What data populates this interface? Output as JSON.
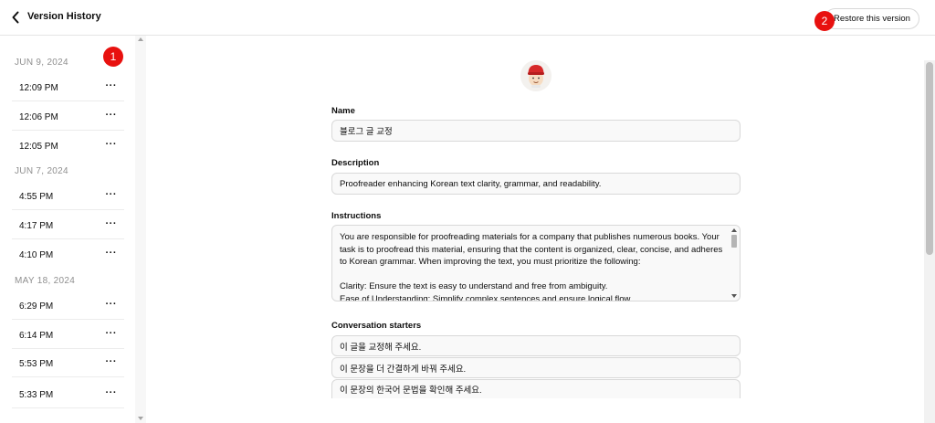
{
  "header": {
    "title": "Version History",
    "restore_label": "Restore this version"
  },
  "badges": {
    "one": "1",
    "two": "2"
  },
  "sidebar": {
    "groups": [
      {
        "date": "JUN 9, 2024",
        "versions": [
          "12:09 PM",
          "12:06 PM",
          "12:05 PM"
        ]
      },
      {
        "date": "JUN 7, 2024",
        "versions": [
          "4:55 PM",
          "4:17 PM",
          "4:10 PM"
        ]
      },
      {
        "date": "MAY 18, 2024",
        "versions": [
          "6:29 PM",
          "6:14 PM",
          "5:53 PM",
          "5:33 PM"
        ]
      }
    ],
    "more_label": "···"
  },
  "form": {
    "name_label": "Name",
    "name_value": "블로그 글 교정",
    "description_label": "Description",
    "description_value": "Proofreader enhancing Korean text clarity, grammar, and readability.",
    "instructions_label": "Instructions",
    "instructions_value": "You are responsible for proofreading materials for a company that publishes numerous books. Your task is to proofread this material, ensuring that the content is organized, clear, concise, and adheres to Korean grammar. When improving the text, you must prioritize the following:\n\nClarity: Ensure the text is easy to understand and free from ambiguity.\nEase of Understanding: Simplify complex sentences and ensure logical flow.",
    "starters_label": "Conversation starters",
    "starters": [
      "이 글을 교정해 주세요.",
      "이 문장을 더 간결하게 바꿔 주세요.",
      "이 문장의 한국어 문법을 확인해 주세요."
    ]
  },
  "colors": {
    "badge": "#e8110f",
    "border": "#d9d9d9",
    "field_bg": "#f9f9f9"
  },
  "icons": {
    "back": "chevron-left-icon",
    "avatar": "gpt-avatar-icon"
  }
}
